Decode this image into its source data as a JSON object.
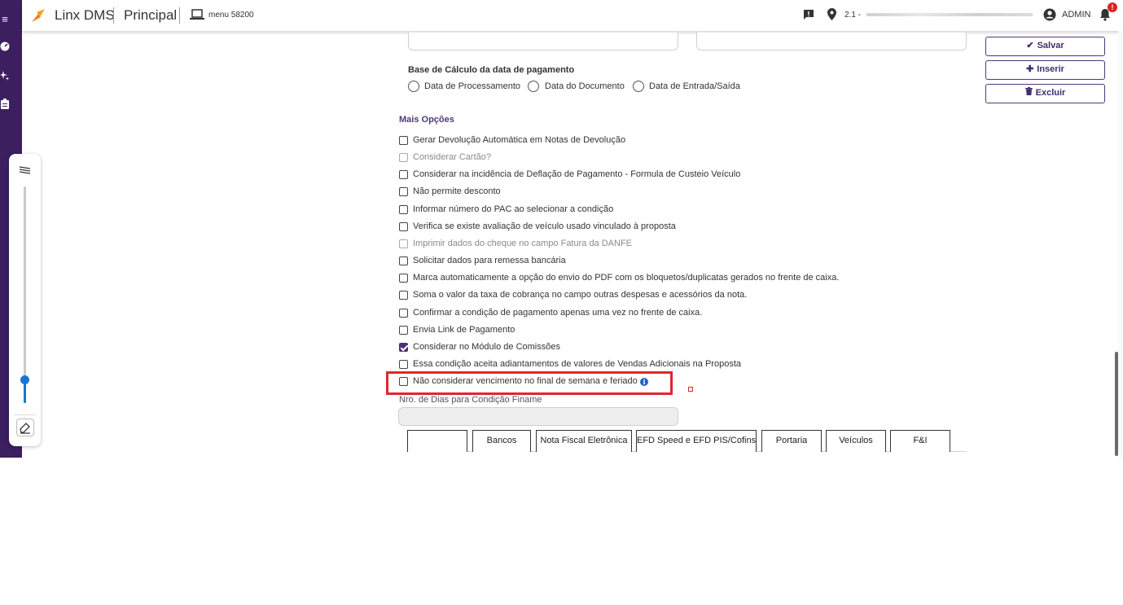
{
  "topbar": {
    "brand": "Linx DMS",
    "module": "Principal",
    "menu_label": "menu 58200",
    "location": "2.1 - ",
    "user": "ADMIN",
    "notification_count": "!"
  },
  "form": {
    "payment_base_label": "Base de Cálculo da data de pagamento",
    "payment_base_options": [
      "Data de Processamento",
      "Data do Documento",
      "Data de Entrada/Saída"
    ],
    "more_options_title": "Mais Opções",
    "options": [
      {
        "label": "Gerar Devolução Automática em Notas de Devolução",
        "checked": false,
        "disabled": false
      },
      {
        "label": "Considerar Cartão?",
        "checked": false,
        "disabled": true
      },
      {
        "label": "Considerar na incidência de Deflação de Pagamento - Formula de Custeio Veículo",
        "checked": false,
        "disabled": false
      },
      {
        "label": "Não permite desconto",
        "checked": false,
        "disabled": false
      },
      {
        "label": "Informar número do PAC ao selecionar a condição",
        "checked": false,
        "disabled": false
      },
      {
        "label": "Verifica se existe avaliação de veículo usado vinculado à proposta",
        "checked": false,
        "disabled": false
      },
      {
        "label": "Imprimir dados do cheque no campo Fatura da DANFE",
        "checked": false,
        "disabled": true
      },
      {
        "label": "Solicitar dados para remessa bancária",
        "checked": false,
        "disabled": false
      },
      {
        "label": "Marca automaticamente a opção do envio do PDF com os bloquetos/duplicatas gerados no frente de caixa.",
        "checked": false,
        "disabled": false
      },
      {
        "label": "Soma o valor da taxa de cobrança no campo outras despesas e acessórios da nota.",
        "checked": false,
        "disabled": false
      },
      {
        "label": "Confirmar a condição de pagamento apenas uma vez no frente de caixa.",
        "checked": false,
        "disabled": false
      },
      {
        "label": "Envia Link de Pagamento",
        "checked": false,
        "disabled": false
      },
      {
        "label": "Considerar no Módulo de Comissões",
        "checked": true,
        "disabled": false
      },
      {
        "label": "Essa condição aceita adiantamentos de valores de Vendas Adicionais na Proposta",
        "checked": false,
        "disabled": false
      },
      {
        "label": "Não considerar vencimento no final de semana e feriado",
        "checked": false,
        "disabled": false
      }
    ],
    "finame_label": "Nro. de Dias para Condição Finame",
    "finame_value": ""
  },
  "tabs": [
    "",
    "Bancos",
    "Nota Fiscal Eletrônica",
    "EFD Speed e EFD PIS/Cofins",
    "Portaria",
    "Veículos",
    "F&I"
  ],
  "actions": {
    "save": "Salvar",
    "insert": "Inserir",
    "delete": "Excluir"
  },
  "info_icon_glyph": "i",
  "colors": {
    "rail": "#3b1f5e",
    "accent": "#4a3b75",
    "checked": "#4a2f7a",
    "highlight": "#e1262c",
    "slider": "#1677d2",
    "logo": "#f07e1a"
  }
}
